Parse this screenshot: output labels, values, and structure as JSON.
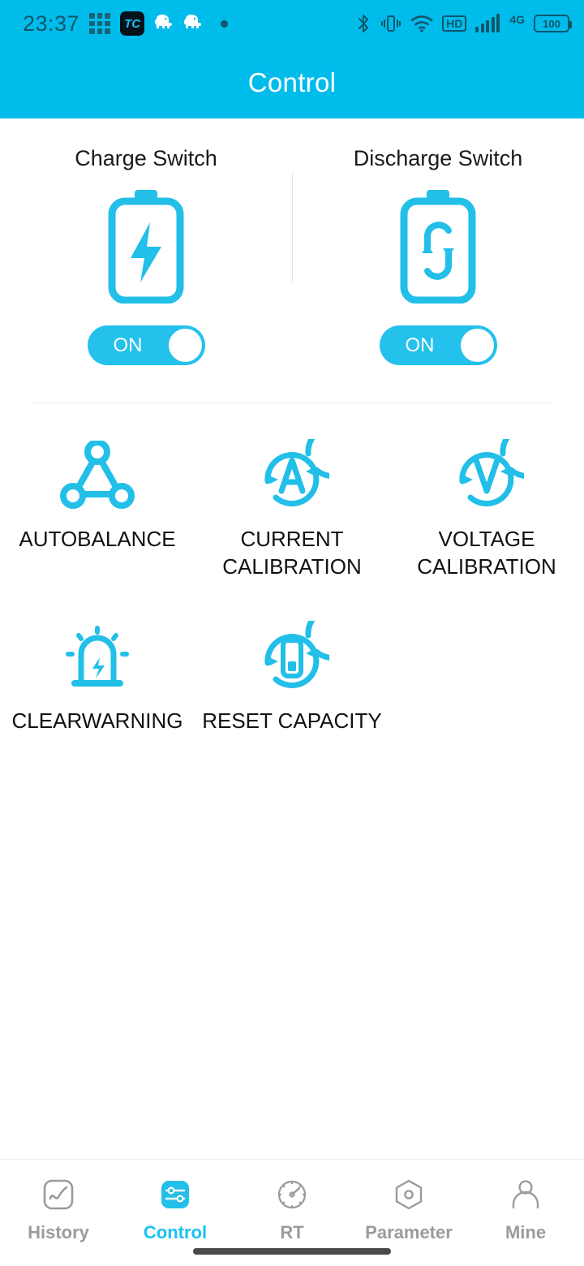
{
  "status_bar": {
    "time": "23:37",
    "app_badge_text": "TC",
    "left_icons": [
      "grid-icon",
      "tc-app-icon",
      "elephant-icon",
      "elephant-icon",
      "dot-icon"
    ],
    "right_icons": [
      "bluetooth-icon",
      "vibrate-icon",
      "wifi-icon",
      "hd-icon",
      "signal-icon",
      "battery-icon"
    ],
    "hd_label": "HD",
    "network_label": "4G",
    "battery_level": "100"
  },
  "app_bar": {
    "title": "Control",
    "background_color": "#00BCEB"
  },
  "switches": [
    {
      "title": "Charge Switch",
      "icon": "battery-charging-icon",
      "state_label": "ON",
      "enabled": true
    },
    {
      "title": "Discharge Switch",
      "icon": "battery-discharge-cycle-icon",
      "state_label": "ON",
      "enabled": true
    }
  ],
  "actions": [
    {
      "label": "AUTOBALANCE",
      "icon": "triangle-nodes-icon"
    },
    {
      "label": "CURRENT\nCALIBRATION",
      "line1": "CURRENT",
      "line2": "CALIBRATION",
      "icon": "ampere-refresh-icon"
    },
    {
      "label": "VOLTAGE\nCALIBRATION",
      "line1": "VOLTAGE",
      "line2": "CALIBRATION",
      "icon": "volt-refresh-icon"
    },
    {
      "label": "CLEARWARNING",
      "icon": "alarm-bolt-icon"
    },
    {
      "label": "RESET CAPACITY",
      "icon": "battery-refresh-icon"
    }
  ],
  "bottom_nav": {
    "items": [
      {
        "label": "History",
        "icon": "chart-square-icon",
        "active": false
      },
      {
        "label": "Control",
        "icon": "sliders-square-icon",
        "active": true
      },
      {
        "label": "RT",
        "icon": "gauge-icon",
        "active": false
      },
      {
        "label": "Parameter",
        "icon": "hex-nut-icon",
        "active": false
      },
      {
        "label": "Mine",
        "icon": "person-icon",
        "active": false
      }
    ]
  },
  "colors": {
    "accent": "#00BCEB",
    "icon_cyan": "#22BFE8",
    "toggle_track": "#23C1EC",
    "nav_inactive": "#9b9b9b",
    "nav_active": "#17C1F3",
    "divider": "#ececec",
    "text_primary": "#111111"
  }
}
